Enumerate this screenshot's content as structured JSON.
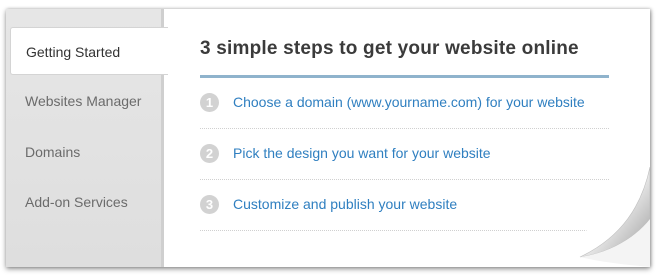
{
  "sidebar": {
    "items": [
      {
        "label": "Getting Started",
        "active": true
      },
      {
        "label": "Websites Manager",
        "active": false
      },
      {
        "label": "Domains",
        "active": false
      },
      {
        "label": "Add-on Services",
        "active": false
      }
    ]
  },
  "main": {
    "title": "3 simple steps to get your website online",
    "steps": [
      {
        "number": "1",
        "label": "Choose a domain (www.yourname.com) for your website"
      },
      {
        "number": "2",
        "label": "Pick the design you want for your website"
      },
      {
        "number": "3",
        "label": "Customize and publish your website"
      }
    ]
  },
  "colors": {
    "link": "#2f7fc0",
    "title_rule": "#8fb3cc",
    "sidebar_bg": "#e2e2e2",
    "step_badge": "#d2d2d2"
  }
}
